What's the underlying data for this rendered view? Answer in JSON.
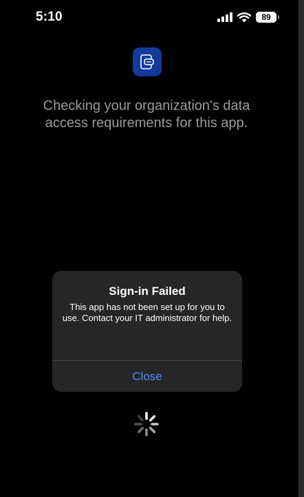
{
  "status_bar": {
    "time": "5:10",
    "battery_level": "89",
    "icons": [
      "cellular-signal-icon",
      "wifi-icon",
      "battery-icon"
    ]
  },
  "app_icon": {
    "icon": "company-portal-icon",
    "color": "#123a9a"
  },
  "main": {
    "checking_message": "Checking your organization's data access requirements for this app."
  },
  "alert": {
    "title": "Sign-in Failed",
    "message": "This app has not been set up for you to use. Contact your IT administrator for help.",
    "button_label": "Close",
    "button_color": "#4f8cf7"
  },
  "spinner": {
    "icon": "loading-spinner-icon"
  }
}
